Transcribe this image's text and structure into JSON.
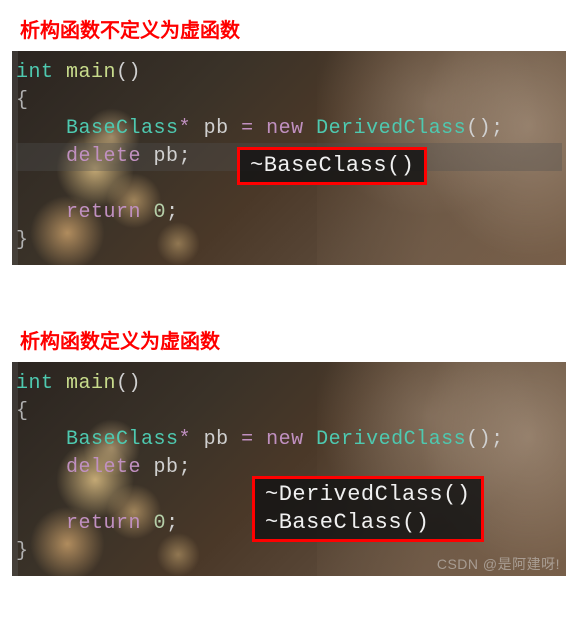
{
  "section1": {
    "heading": "析构函数不定义为虚函数",
    "code": {
      "l1_int": "int",
      "l1_main": " main",
      "l1_paren": "()",
      "l2_brace": "{",
      "l3_indent": "    ",
      "l3_type": "BaseClass",
      "l3_star": "*",
      "l3_pb": " pb ",
      "l3_eq": "=",
      "l3_sp": " ",
      "l3_new": "new",
      "l3_sp2": " ",
      "l3_dc": "DerivedClass",
      "l3_end": "();",
      "l4_indent": "    ",
      "l4_delete": "delete",
      "l4_sp": " ",
      "l4_pb": "pb",
      "l4_semi": ";",
      "l6_indent": "    ",
      "l6_return": "return",
      "l6_sp": " ",
      "l6_zero": "0",
      "l6_semi": ";",
      "l7_brace": "}"
    },
    "output": {
      "line1": "~BaseClass()"
    }
  },
  "section2": {
    "heading": "析构函数定义为虚函数",
    "code": {
      "l1_int": "int",
      "l1_main": " main",
      "l1_paren": "()",
      "l2_brace": "{",
      "l3_indent": "    ",
      "l3_type": "BaseClass",
      "l3_star": "*",
      "l3_pb": " pb ",
      "l3_eq": "=",
      "l3_sp": " ",
      "l3_new": "new",
      "l3_sp2": " ",
      "l3_dc": "DerivedClass",
      "l3_end": "();",
      "l4_indent": "    ",
      "l4_delete": "delete",
      "l4_sp": " ",
      "l4_pb": "pb",
      "l4_semi": ";",
      "l6_indent": "    ",
      "l6_return": "return",
      "l6_sp": " ",
      "l6_zero": "0",
      "l6_semi": ";",
      "l7_brace": "}"
    },
    "output": {
      "line1": "~DerivedClass()",
      "line2": "~BaseClass()"
    },
    "watermark": "CSDN @是阿建呀!"
  }
}
